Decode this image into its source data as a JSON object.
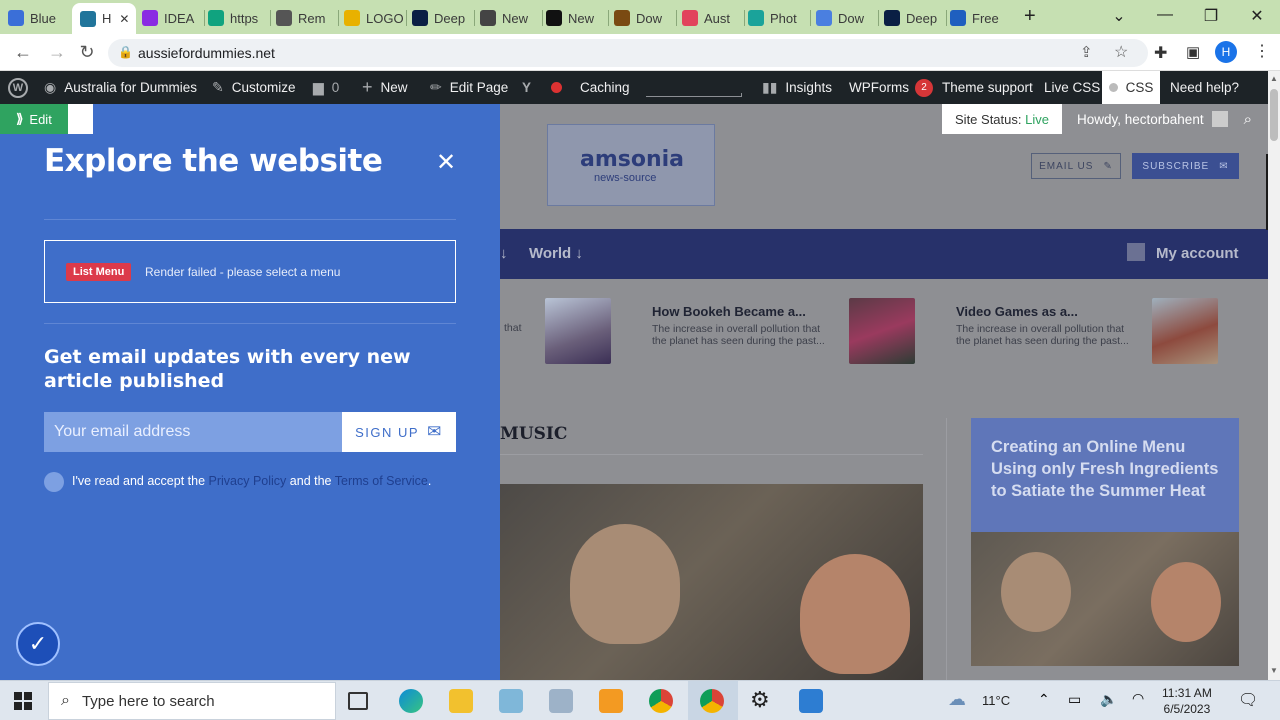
{
  "browser": {
    "tabs": [
      {
        "label": "Blue",
        "color": "#3b6fd8"
      },
      {
        "label": "H",
        "color": "#21759b",
        "active": true
      },
      {
        "label": "IDEA",
        "color": "#8a2be2"
      },
      {
        "label": "https",
        "color": "#10a37f"
      },
      {
        "label": "Rem",
        "color": "#555555"
      },
      {
        "label": "LOGO",
        "color": "#e8b100"
      },
      {
        "label": "Deep",
        "color": "#0a1f44"
      },
      {
        "label": "New",
        "color": "#444444"
      },
      {
        "label": "New",
        "color": "#111111"
      },
      {
        "label": "Dow",
        "color": "#7a4a12"
      },
      {
        "label": "Aust",
        "color": "#e2445c"
      },
      {
        "label": "Phot",
        "color": "#1aa39a"
      },
      {
        "label": "Dow",
        "color": "#4a7fe0"
      },
      {
        "label": "Deep",
        "color": "#0a1f44"
      },
      {
        "label": "Free",
        "color": "#1f5fbf"
      }
    ],
    "url": "aussiefordummies.net",
    "profile_initial": "H"
  },
  "wpbar": {
    "site_name": "Australia for Dummies",
    "customize": "Customize",
    "comments": "0",
    "new": "New",
    "edit_page": "Edit Page",
    "caching": "Caching",
    "insights": "Insights",
    "wpforms": "WPForms",
    "wpforms_count": "2",
    "theme_support": "Theme support",
    "live_css": "Live CSS",
    "css": "CSS",
    "need_help": "Need help?"
  },
  "editor": {
    "edit_label": "Edit",
    "site_status_label": "Site Status:",
    "site_status_value": "Live",
    "howdy": "Howdy, hectorbahent"
  },
  "panel": {
    "title": "Explore the website",
    "list_menu_label": "List Menu",
    "list_menu_message": "Render failed - please select a menu",
    "subscribe_title": "Get email updates with every new article published",
    "email_placeholder": "Your email address",
    "signup_label": "SIGN UP",
    "consent_pre": "I've read and accept the ",
    "privacy_link": "Privacy Policy",
    "consent_mid": " and the ",
    "terms_link": "Terms of Service",
    "consent_end": "."
  },
  "site": {
    "logo_name": "amsonia",
    "logo_sub": "news-source",
    "email_us": "EMAIL US",
    "subscribe": "SUBSCRIBE",
    "nav_world": "World",
    "my_account": "My account",
    "articles": [
      {
        "title": "How Bookeh Became a...",
        "desc": "The increase in overall pollution that the planet has seen during the past..."
      },
      {
        "title": "Video Games as a...",
        "desc": "The increase in overall pollution that the planet has seen during the past..."
      }
    ],
    "partial_text": "that",
    "section_heading": "MUSIC",
    "feature_title": "Creating an Online Menu Using only Fresh Ingredients to Satiate the Summer Heat"
  },
  "screen_recorder": "screenrec",
  "taskbar": {
    "search_placeholder": "Type here to search",
    "temperature": "11°C",
    "time": "11:31 AM",
    "date": "6/5/2023"
  }
}
